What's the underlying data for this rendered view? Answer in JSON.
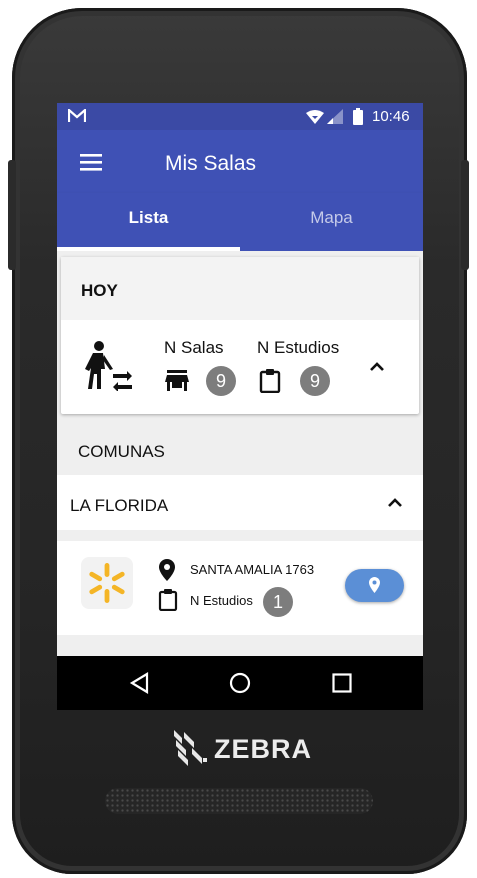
{
  "status_bar": {
    "time": "10:46",
    "app_icon": "gmail-icon",
    "wifi_icon": "wifi-icon",
    "signal_icon": "signal-icon",
    "battery_icon": "battery-icon"
  },
  "app_bar": {
    "title": "Mis Salas",
    "menu_icon": "hamburger-menu-icon"
  },
  "tabs": [
    {
      "label": "Lista",
      "active": true
    },
    {
      "label": "Mapa",
      "active": false
    }
  ],
  "summary": {
    "header": "HOY",
    "salas_label": "N Salas",
    "salas_count": "9",
    "estudios_label": "N Estudios",
    "estudios_count": "9"
  },
  "section_title": "COMUNAS",
  "comuna": {
    "name": "LA FLORIDA",
    "stores": [
      {
        "address": "SANTA AMALIA 1763",
        "estudios_label": "N Estudios",
        "estudios_count": "1",
        "logo": "walmart-spark-logo"
      }
    ]
  },
  "device_brand": "ZEBRA",
  "colors": {
    "primary": "#3f51b5",
    "status": "#3b4aa5",
    "badge": "#7d7d7d",
    "location_button": "#5b8fd6"
  }
}
